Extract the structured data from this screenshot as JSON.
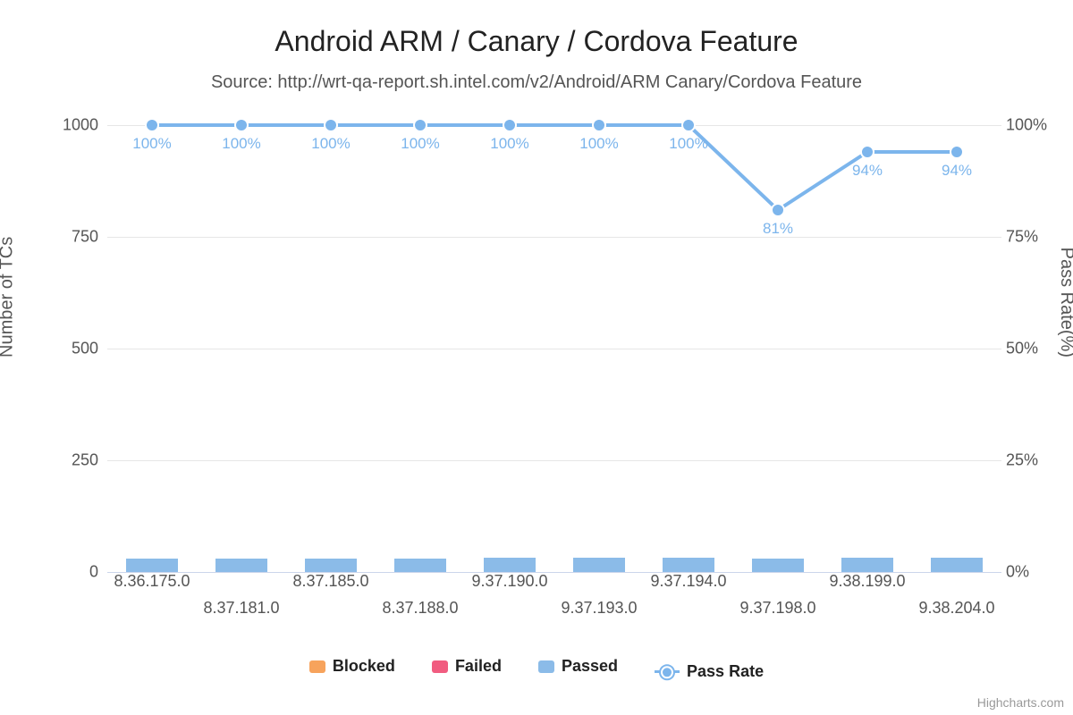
{
  "chart_data": {
    "type": "bar+line",
    "title": "Android ARM / Canary / Cordova Feature",
    "subtitle": "Source: http://wrt-qa-report.sh.intel.com/v2/Android/ARM Canary/Cordova Feature",
    "categories": [
      "8.36.175.0",
      "8.37.181.0",
      "8.37.185.0",
      "8.37.188.0",
      "9.37.190.0",
      "9.37.193.0",
      "9.37.194.0",
      "9.37.198.0",
      "9.38.199.0",
      "9.38.204.0"
    ],
    "y_left": {
      "label": "Number of TCs",
      "min": 0,
      "max": 1000,
      "ticks": [
        0,
        250,
        500,
        750,
        1000
      ]
    },
    "y_right": {
      "label": "Pass Rate(%)",
      "min": 0,
      "max": 100,
      "ticks": [
        0,
        25,
        50,
        75,
        100
      ]
    },
    "series": [
      {
        "name": "Blocked",
        "type": "bar",
        "color": "#f7a35c",
        "values": [
          0,
          0,
          0,
          0,
          0,
          0,
          0,
          0,
          0,
          0
        ]
      },
      {
        "name": "Failed",
        "type": "bar",
        "color": "#f15c80",
        "values": [
          0,
          0,
          0,
          0,
          0,
          0,
          0,
          0,
          0,
          0
        ]
      },
      {
        "name": "Passed",
        "type": "bar",
        "color": "#8bbbe8",
        "values": [
          31,
          31,
          31,
          31,
          32,
          32,
          32,
          31,
          32,
          32
        ]
      },
      {
        "name": "Pass Rate",
        "type": "line",
        "color": "#7cb5ec",
        "values": [
          100,
          100,
          100,
          100,
          100,
          100,
          100,
          81,
          94,
          94
        ],
        "labels": [
          "100%",
          "100%",
          "100%",
          "100%",
          "100%",
          "100%",
          "100%",
          "81%",
          "94%",
          "94%"
        ]
      }
    ],
    "legend": [
      "Blocked",
      "Failed",
      "Passed",
      "Pass Rate"
    ],
    "credit": "Highcharts.com"
  }
}
